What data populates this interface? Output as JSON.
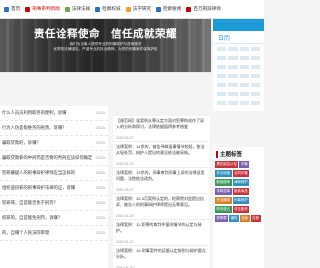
{
  "nav": {
    "items": [
      {
        "label": "首页",
        "color": "#2c6fbf",
        "active": false
      },
      {
        "label": "刑事审判新闻",
        "color": "#c40000",
        "active": true
      },
      {
        "label": "法律法规",
        "color": "#6aa84f",
        "active": false
      },
      {
        "label": "检察权威",
        "color": "#2c6fbf",
        "active": false
      },
      {
        "label": "法学研究",
        "color": "#f1a025",
        "active": false
      },
      {
        "label": "检察要闻",
        "color": "#2c6fbf",
        "active": false
      },
      {
        "label": "百万刑辩律师",
        "color": "#c40000",
        "active": false
      }
    ]
  },
  "hero": {
    "slogan": "责任诠释使命　信任成就荣耀",
    "sub1": "我们为当事人提供专业的刑事辩护与咨询服务",
    "sub2": "优秀的法律团队，严谨专业的执业精神，为您的刑事案件保驾护航"
  },
  "sidebar": {
    "calendar_label": "日历",
    "tags_title": "主题标签",
    "tags": [
      {
        "label": "累犯能否从轻",
        "color": "#c8323a"
      },
      {
        "label": "诈骗",
        "color": "#7b5fb3"
      },
      {
        "label": "非法经营",
        "color": "#2f8fc0"
      },
      {
        "label": "合同诈骗",
        "color": "#c8323a"
      },
      {
        "label": "取保候审",
        "color": "#3b9a5b"
      },
      {
        "label": "律师辩护",
        "color": "#2f8fc0"
      },
      {
        "label": "寻衅滋事",
        "color": "#7b5fb3"
      },
      {
        "label": "贩卖毒品",
        "color": "#c8323a"
      },
      {
        "label": "开设赌场",
        "color": "#d9822b"
      },
      {
        "label": "刑事辩护",
        "color": "#2f8fc0"
      },
      {
        "label": "职务侵占",
        "color": "#3b9a5b"
      },
      {
        "label": "非法集资",
        "color": "#c8323a"
      },
      {
        "label": "受贿罪",
        "color": "#7b5fb3"
      },
      {
        "label": "缓刑",
        "color": "#2f8fc0"
      },
      {
        "label": "走私",
        "color": "#d9822b"
      },
      {
        "label": "自首",
        "color": "#c8323a"
      }
    ]
  },
  "left_list": [
    {
      "title": "什么人员员利用职务的便利，诉赚",
      "date": "2020-"
    },
    {
      "title": "行为人伪造假维务的刑责、诉赚？",
      "date": "2020-"
    },
    {
      "title": "骗取贷款的，诉赚？",
      "date": "2020-"
    },
    {
      "title": "骗取贷款罪的中刑罚是否要的判刑应该如何确定",
      "date": "2020-"
    },
    {
      "title": "犯罪嫌疑人的刑事辩护律师应当怎样的",
      "date": "2020-"
    },
    {
      "title": "组织盗窃罪的刑事辩护法律的应，诉赚",
      "date": "2020-"
    },
    {
      "title": "犯罪罪，自首能否免于刑罚？",
      "date": "2020-"
    },
    {
      "title": "权罪的，自首能免刑罚，诉赚？",
      "date": "2020-"
    },
    {
      "title": "的，自赚个人民法院审理",
      "date": "2020-"
    }
  ],
  "mid_list": [
    {
      "text": "【规范网】该案例从罪认定方面对犯罪构成作了深入的分析和探讨，法律依据值得参考借鉴",
      "meta": "2020-06-07"
    },
    {
      "text": "法律案例：14岁的，被告寻衅滋事情节较轻，依法从轻处罚，辩护人提出的意见依法被采纳。",
      "meta": "2020-05-15"
    },
    {
      "text": "法律案例：13岁的，刑事审判刑事上诉的法律适用问题，法院依法改判。",
      "meta": "2020-05-07"
    },
    {
      "text": "法律案例：12-3月案例认定的，检察院对此提出抗诉，被告人的刑事辩护律师提出无罪意见。",
      "meta": "2020-04-25"
    },
    {
      "text": "法律案例：11-犯罪的审判中量刑情节的认定与辩护。",
      "meta": "2020-04-12"
    },
    {
      "text": "法律案例：10-刑事案件的证据认定规则与辩护要点分析。",
      "meta": "2020-03-30"
    }
  ]
}
